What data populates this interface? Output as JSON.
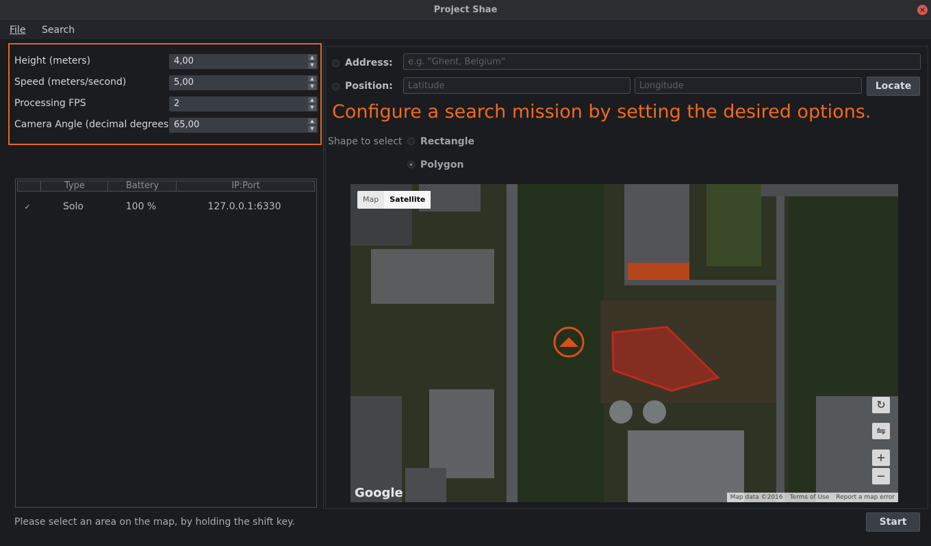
{
  "window": {
    "title": "Project Shae"
  },
  "menu": {
    "file": "File",
    "search": "Search"
  },
  "settings": [
    {
      "label": "Height (meters)",
      "value": "4,00"
    },
    {
      "label": "Speed (meters/second)",
      "value": "5,00"
    },
    {
      "label": "Processing FPS",
      "value": "2"
    },
    {
      "label": "Camera Angle (decimal degrees)",
      "value": "65,00"
    }
  ],
  "drones_table": {
    "headers": [
      "",
      "Type",
      "Battery",
      "IP:Port"
    ],
    "rows": [
      {
        "checked": "✓",
        "type": "Solo",
        "battery": "100 %",
        "ip_port": "127.0.0.1:6330"
      }
    ]
  },
  "location": {
    "address_label": "Address:",
    "address_placeholder": "e.g. \"Ghent, Belgium\"",
    "position_label": "Position:",
    "latitude_placeholder": "Latitude",
    "longitude_placeholder": "Longitude",
    "locate_button": "Locate"
  },
  "instruction": "Configure a search mission by setting the desired options.",
  "shape": {
    "label": "Shape to select",
    "options": [
      "Rectangle",
      "Polygon"
    ],
    "selected": "Polygon"
  },
  "map": {
    "type_options": [
      "Map",
      "Satellite"
    ],
    "active_type": "Satellite",
    "logo": "Google",
    "attribution": [
      "Map data ©2016",
      "Terms of Use",
      "Report a map error"
    ],
    "polygon_color": "#c0281e",
    "drone_marker_color": "#d9501a"
  },
  "status": "Please select an area on the map, by holding the shift key.",
  "start_button": "Start",
  "colors": {
    "accent": "#e8661c",
    "background": "#1a1c20"
  }
}
